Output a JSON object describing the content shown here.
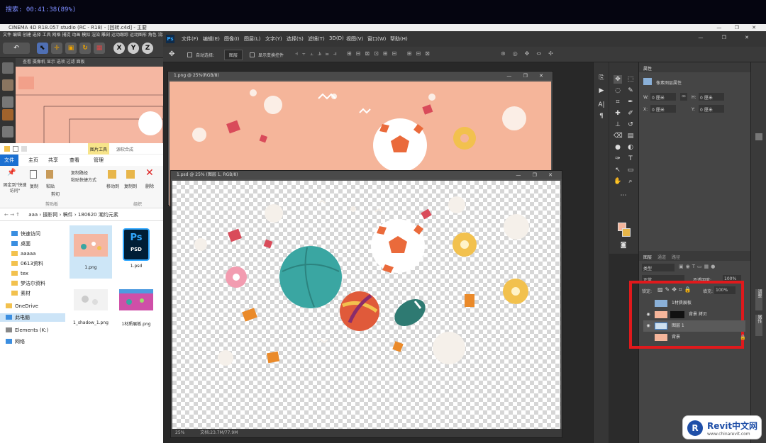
{
  "recording_bar": {
    "text": "搜索: 00:41:38(89%)"
  },
  "c4d": {
    "title": "CINEMA 4D R18.057 studio (RC - R18) - [回转.c4d] - 主要",
    "window_controls": "— ❐ ✕",
    "menu": "文件 编辑 创建 选择 工具 网格 捕捉 动画 模拟 渲染 雕刻 运动跟踪 运动图形 角色 流水线 插件 脚本 窗口 帮助",
    "view_menu": "查看 摄像机 显示 选项 过滤 面板",
    "toolbar": [
      "X",
      "Y",
      "Z"
    ]
  },
  "explorer": {
    "title_tab_picture": "图片工具",
    "title_tab_manage": "管理",
    "title_path_hint": "源软合成",
    "tabs": [
      "文件",
      "主页",
      "共享",
      "查看"
    ],
    "ribbon": {
      "pin": "固定到\"快速访问\"",
      "copy": "复制",
      "paste": "粘贴",
      "copy_path": "复制路径",
      "paste_shortcut": "粘贴快捷方式",
      "cut": "剪切",
      "clipboard": "剪贴板",
      "move_to": "移动到",
      "copy_to": "复制到",
      "delete": "删除",
      "organize": "组织"
    },
    "address": [
      "aaa",
      "摄影网",
      "稿件",
      "180620 潮约元素"
    ],
    "nav": [
      {
        "label": "快速访问",
        "type": "star"
      },
      {
        "label": "桌面",
        "type": "desktop"
      },
      {
        "label": "aaaaa",
        "type": "folder"
      },
      {
        "label": "0613资料",
        "type": "folder"
      },
      {
        "label": "tex",
        "type": "folder"
      },
      {
        "label": "梦洁尔资料",
        "type": "folder"
      },
      {
        "label": "素材",
        "type": "folder"
      },
      {
        "label": "OneDrive",
        "type": "cloud"
      },
      {
        "label": "此电脑",
        "type": "pc"
      },
      {
        "label": "Elements (K:)",
        "type": "drive"
      },
      {
        "label": "网络",
        "type": "network"
      }
    ],
    "files": [
      "1.png",
      "1.psd",
      "1_shadow_1.png",
      "1材质展板.png"
    ]
  },
  "photoshop": {
    "logo": "Ps",
    "menu": [
      "文件(F)",
      "编辑(E)",
      "图像(I)",
      "图层(L)",
      "文字(Y)",
      "选择(S)",
      "滤镜(T)",
      "3D(D)",
      "视图(V)",
      "窗口(W)",
      "帮助(H)"
    ],
    "window_controls": "— ❐ ✕",
    "options": {
      "auto_select": "自动选择:",
      "auto_select_value": "图层",
      "show_transform": "显示变换控件"
    },
    "doc1": {
      "title": "1.png @ 25%(RGB/8)"
    },
    "doc2": {
      "title": "1.psd @ 25% (图层 1, RGB/8)",
      "zoom": "25%",
      "doc_info": "文档:23.7M/77.9M"
    },
    "properties": {
      "tab": "属性",
      "section": "像素图层属性",
      "w_label": "W:",
      "w_value": "0 厘米",
      "h_label": "H:",
      "h_value": "0 厘米",
      "x_label": "X:",
      "x_value": "0 厘米",
      "y_label": "Y:",
      "y_value": "0 厘米"
    },
    "layers_panel": {
      "tabs": [
        "图层",
        "通道",
        "路径"
      ],
      "filter": "类型",
      "blend_mode": "正常",
      "opacity_label": "不透明度:",
      "opacity_value": "100%",
      "lock_label": "锁定:",
      "fill_label": "填充:",
      "fill_value": "100%",
      "layers": [
        {
          "name": "1材质展板",
          "visible": false
        },
        {
          "name": "背景 拷贝",
          "visible": true
        },
        {
          "name": "图层 1",
          "visible": true,
          "selected": true
        },
        {
          "name": "背景",
          "visible": false,
          "locked": true
        }
      ]
    },
    "dock": [
      "调整",
      "属性"
    ],
    "highlight_color": "#e0191c"
  },
  "watermark": {
    "brand": "Revit中文网",
    "url": "www.chinarevit.com"
  },
  "colors": {
    "peach": "#f5b7a2",
    "teal": "#3aa6a2",
    "orange_ball": "#ea6a3b"
  }
}
